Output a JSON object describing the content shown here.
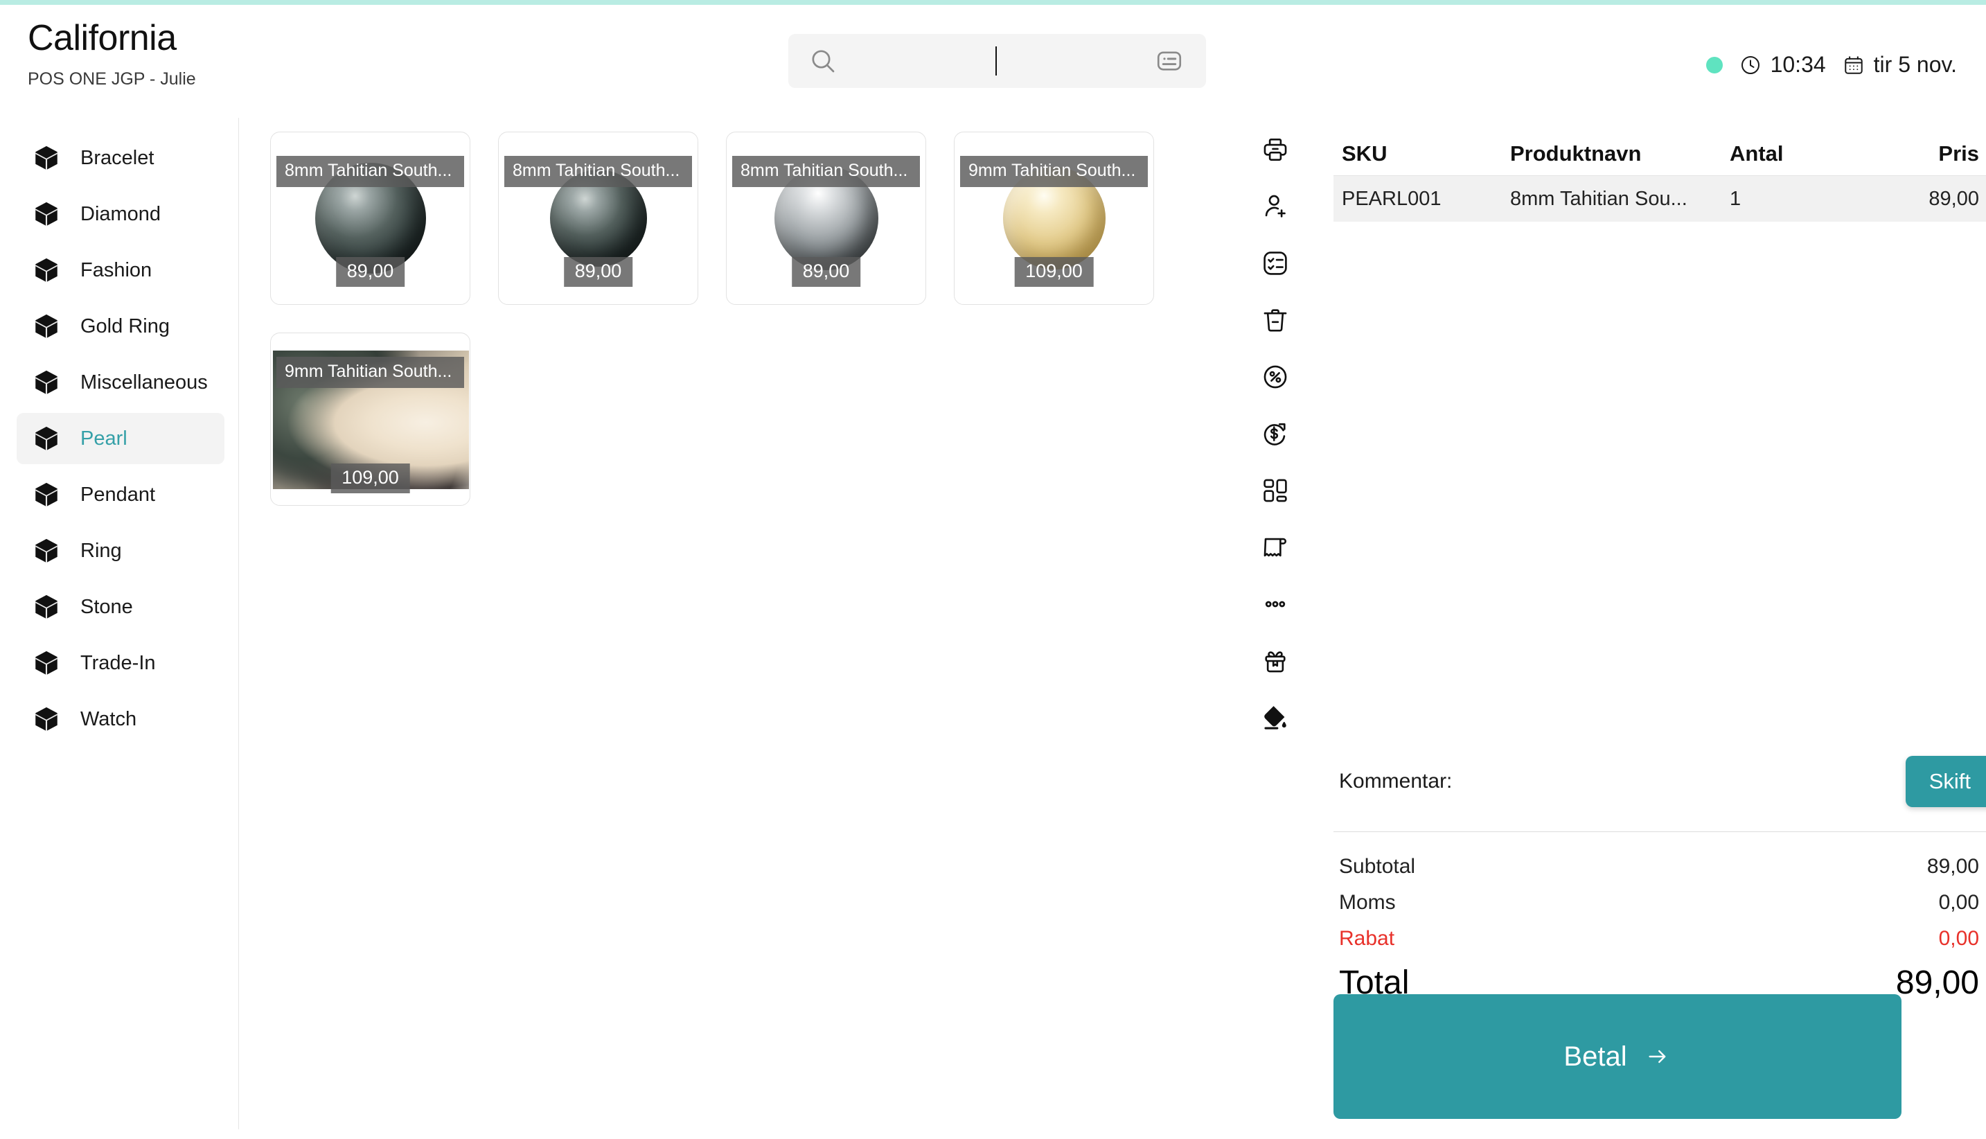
{
  "header": {
    "store_name": "California",
    "subtitle": "POS ONE JGP - Julie",
    "search": {
      "placeholder": "",
      "value": ""
    },
    "status": {
      "online_color": "#5fe3c0",
      "time": "10:34",
      "date": "tir 5 nov."
    }
  },
  "sidebar": {
    "items": [
      {
        "label": "Bracelet",
        "active": false
      },
      {
        "label": "Diamond",
        "active": false
      },
      {
        "label": "Fashion",
        "active": false
      },
      {
        "label": "Gold Ring",
        "active": false
      },
      {
        "label": "Miscellaneous",
        "active": false
      },
      {
        "label": "Pearl",
        "active": true
      },
      {
        "label": "Pendant",
        "active": false
      },
      {
        "label": "Ring",
        "active": false
      },
      {
        "label": "Stone",
        "active": false
      },
      {
        "label": "Trade-In",
        "active": false
      },
      {
        "label": "Watch",
        "active": false
      }
    ]
  },
  "products": [
    {
      "name": "8mm Tahitian South...",
      "price": "89,00",
      "art": "pearl-dark"
    },
    {
      "name": "8mm Tahitian South...",
      "price": "89,00",
      "art": "pearl-dark-sm"
    },
    {
      "name": "8mm Tahitian South...",
      "price": "89,00",
      "art": "pearl-silver"
    },
    {
      "name": "9mm Tahitian South...",
      "price": "109,00",
      "art": "pearl-gold"
    },
    {
      "name": "9mm Tahitian South...",
      "price": "109,00",
      "art": "photo-strand"
    }
  ],
  "toolbar": {
    "icons": [
      "printer-icon",
      "add-customer-icon",
      "checklist-icon",
      "trash-icon",
      "discount-percent-icon",
      "refund-dollar-icon",
      "dashboard-grid-icon",
      "receipt-icon",
      "more-options-icon",
      "gift-icon",
      "paint-bucket-icon"
    ]
  },
  "cart": {
    "columns": {
      "sku": "SKU",
      "name": "Produktnavn",
      "qty": "Antal",
      "price": "Pris"
    },
    "rows": [
      {
        "sku": "PEARL001",
        "name": "8mm Tahitian Sou...",
        "qty": "1",
        "price": "89,00"
      }
    ],
    "comment_label": "Kommentar:",
    "comment_value": "",
    "change_button": "Skift",
    "totals": [
      {
        "label": "Subtotal",
        "value": "89,00"
      },
      {
        "label": "Moms",
        "value": "0,00"
      },
      {
        "label": "Rabat",
        "value": "0,00"
      }
    ],
    "grand_total": {
      "label": "Total",
      "value": "89,00"
    },
    "pay_button": "Betal"
  },
  "colors": {
    "accent_teal": "#2e9aa2",
    "active_text": "#35a0a8",
    "discount_red": "#e8312a",
    "status_dot": "#5fe3c0",
    "top_strip": "#b9ece3"
  }
}
